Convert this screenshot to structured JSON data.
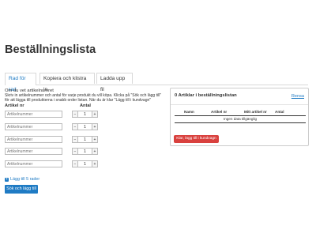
{
  "page": {
    "title": "Beställningslista"
  },
  "tabs": [
    {
      "label": "Rad för rad"
    },
    {
      "label": "Kopiera och klistra in"
    },
    {
      "label": "Ladda upp fil"
    }
  ],
  "form": {
    "info": "Om du vet artikelnumret",
    "description": "Skriv in artikelnummer och antal för varje produkt du vill köpa. Klicka på \"Sök och lägg till\" för att lägga till produkterna i snabb order listan. När du är klar \"Lägg till i kundvagn\"",
    "col_article": "Artikel nr",
    "col_qty": "Antal",
    "placeholder": "Artikelnummer",
    "rows": [
      {
        "qty": "1"
      },
      {
        "qty": "1"
      },
      {
        "qty": "1"
      },
      {
        "qty": "1"
      },
      {
        "qty": "1"
      }
    ],
    "minus": "−",
    "plus": "+",
    "add_rows": "Lägg till 5 rader",
    "search_add": "Sök och lägg till"
  },
  "cart": {
    "title": "0 Artiklar i beställningslistan",
    "clear": "Rensa",
    "columns": {
      "name": "Namn",
      "article": "Artikel nr",
      "price": "Mitt artikel nr",
      "qty": "Antal"
    },
    "empty": "Ingen data tillgänglig",
    "add_to_cart": "Klar, lägg till i kundvagn"
  }
}
